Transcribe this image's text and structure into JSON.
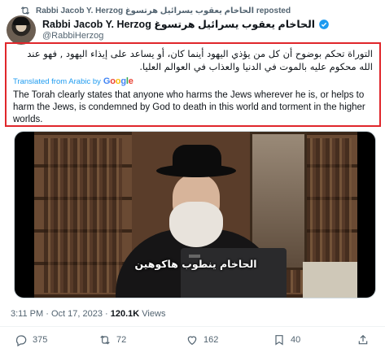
{
  "repost": {
    "label": "Rabbi Jacob Y. Herzog الحاخام يعقوب يسرائيل هرتسوغ reposted",
    "icon": "repost-icon"
  },
  "author": {
    "name": "Rabbi Jacob Y. Herzog الحاخام يعقوب يسرائيل هرتسوغ",
    "handle": "@RabbiHerzog",
    "verified_color": "#1d9bf0"
  },
  "post": {
    "arabic_text": "التوراة تحكم بوضوح أن كل من يؤذي اليهود أينما كان، أو يساعد على إيذاء اليهود , فهو عند الله محكوم عليه بالموت في الدنيا والعذاب في العوالم العليا.",
    "translated_label": "Translated from Arabic by",
    "translator": "Google",
    "english_text": "The Torah clearly states that anyone who harms the Jews wherever he is, or helps to harm the Jews, is condemned by God to death in this world and torment in the higher worlds.",
    "video_subtitle": "الحاخام ينطوب هاكوهين"
  },
  "meta": {
    "time": "3:11 PM",
    "date": "Oct 17, 2023",
    "separator": "·",
    "views_count": "120.1K",
    "views_label": "Views"
  },
  "actions": {
    "replies": "375",
    "reposts": "72",
    "likes": "162",
    "bookmarks": "40"
  },
  "colors": {
    "highlight_border": "#e0262b",
    "secondary_text": "#536471",
    "link": "#1d9bf0"
  }
}
